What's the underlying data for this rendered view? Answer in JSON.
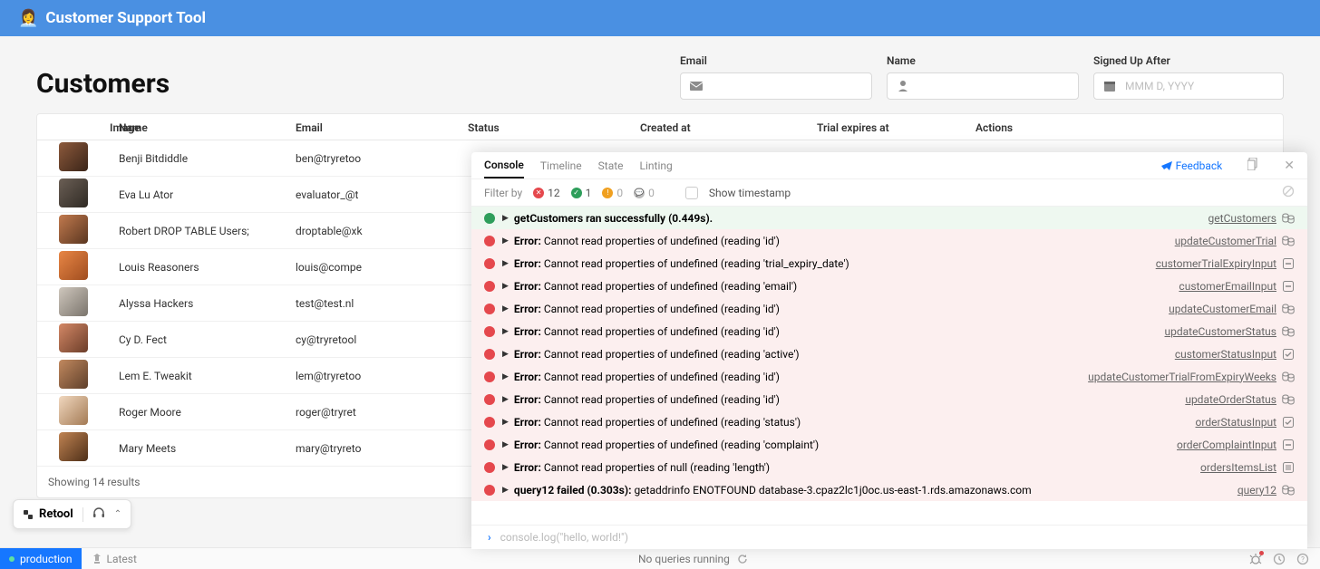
{
  "header": {
    "emoji": "👩‍💼",
    "title": "Customer Support Tool"
  },
  "page": {
    "heading": "Customers"
  },
  "filters": {
    "email": {
      "label": "Email",
      "placeholder": ""
    },
    "name": {
      "label": "Name",
      "placeholder": ""
    },
    "signed_up_after": {
      "label": "Signed Up After",
      "placeholder": "MMM D, YYYY"
    }
  },
  "table": {
    "columns": [
      "Image",
      "Name",
      "Email",
      "Status",
      "Created at",
      "Trial expires at",
      "Actions"
    ],
    "rows": [
      {
        "name": "Benji Bitdiddle",
        "email": "ben@tryretoo"
      },
      {
        "name": "Eva Lu Ator",
        "email": "evaluator_@t"
      },
      {
        "name": "Robert DROP TABLE Users;",
        "email": "droptable@xk"
      },
      {
        "name": "Louis Reasoners",
        "email": "louis@compe"
      },
      {
        "name": "Alyssa Hackers",
        "email": "test@test.nl"
      },
      {
        "name": "Cy D. Fect",
        "email": "cy@tryretool"
      },
      {
        "name": "Lem E. Tweakit",
        "email": "lem@tryretoo"
      },
      {
        "name": "Roger Moore",
        "email": "roger@tryret"
      },
      {
        "name": "Mary Meets",
        "email": "mary@tryreto"
      }
    ],
    "results_text": "Showing 14 results"
  },
  "retool_pill": {
    "label": "Retool"
  },
  "statusbar": {
    "env": "production",
    "latest": "Latest",
    "center": "No queries running"
  },
  "debug": {
    "tabs": [
      "Console",
      "Timeline",
      "State",
      "Linting"
    ],
    "active_tab": 0,
    "feedback_label": "Feedback",
    "filter_label": "Filter by",
    "counts": {
      "errors": 12,
      "ok": 1,
      "warn": 0,
      "info": 0
    },
    "show_timestamp_label": "Show timestamp",
    "logs": [
      {
        "type": "ok",
        "bold": "getCustomers ran successfully (0.449s).",
        "rest": "",
        "src": "getCustomers",
        "srcType": "query"
      },
      {
        "type": "err",
        "bold": "Error: ",
        "rest": "Cannot read properties of undefined (reading 'id')",
        "src": "updateCustomerTrial",
        "srcType": "query"
      },
      {
        "type": "err",
        "bold": "Error: ",
        "rest": "Cannot read properties of undefined (reading 'trial_expiry_date')",
        "src": "customerTrialExpiryInput",
        "srcType": "component"
      },
      {
        "type": "err",
        "bold": "Error: ",
        "rest": "Cannot read properties of undefined (reading 'email')",
        "src": "customerEmailInput",
        "srcType": "component"
      },
      {
        "type": "err",
        "bold": "Error: ",
        "rest": "Cannot read properties of undefined (reading 'id')",
        "src": "updateCustomerEmail",
        "srcType": "query"
      },
      {
        "type": "err",
        "bold": "Error: ",
        "rest": "Cannot read properties of undefined (reading 'id')",
        "src": "updateCustomerStatus",
        "srcType": "query"
      },
      {
        "type": "err",
        "bold": "Error: ",
        "rest": "Cannot read properties of undefined (reading 'active')",
        "src": "customerStatusInput",
        "srcType": "component-check"
      },
      {
        "type": "err",
        "bold": "Error: ",
        "rest": "Cannot read properties of undefined (reading 'id')",
        "src": "updateCustomerTrialFromExpiryWeeks",
        "srcType": "query"
      },
      {
        "type": "err",
        "bold": "Error: ",
        "rest": "Cannot read properties of undefined (reading 'id')",
        "src": "updateOrderStatus",
        "srcType": "query"
      },
      {
        "type": "err",
        "bold": "Error: ",
        "rest": "Cannot read properties of undefined (reading 'status')",
        "src": "orderStatusInput",
        "srcType": "component-check"
      },
      {
        "type": "err",
        "bold": "Error: ",
        "rest": "Cannot read properties of undefined (reading 'complaint')",
        "src": "orderComplaintInput",
        "srcType": "component"
      },
      {
        "type": "err",
        "bold": "Error: ",
        "rest": "Cannot read properties of null (reading 'length')",
        "src": "ordersItemsList",
        "srcType": "component-list"
      },
      {
        "type": "err",
        "bold": "query12 failed (0.303s): ",
        "rest": "getaddrinfo ENOTFOUND database-3.cpaz2lc1j0oc.us-east-1.rds.amazonaws.com",
        "src": "query12",
        "srcType": "query"
      }
    ],
    "prompt_placeholder": "console.log(\"hello, world!\")"
  }
}
